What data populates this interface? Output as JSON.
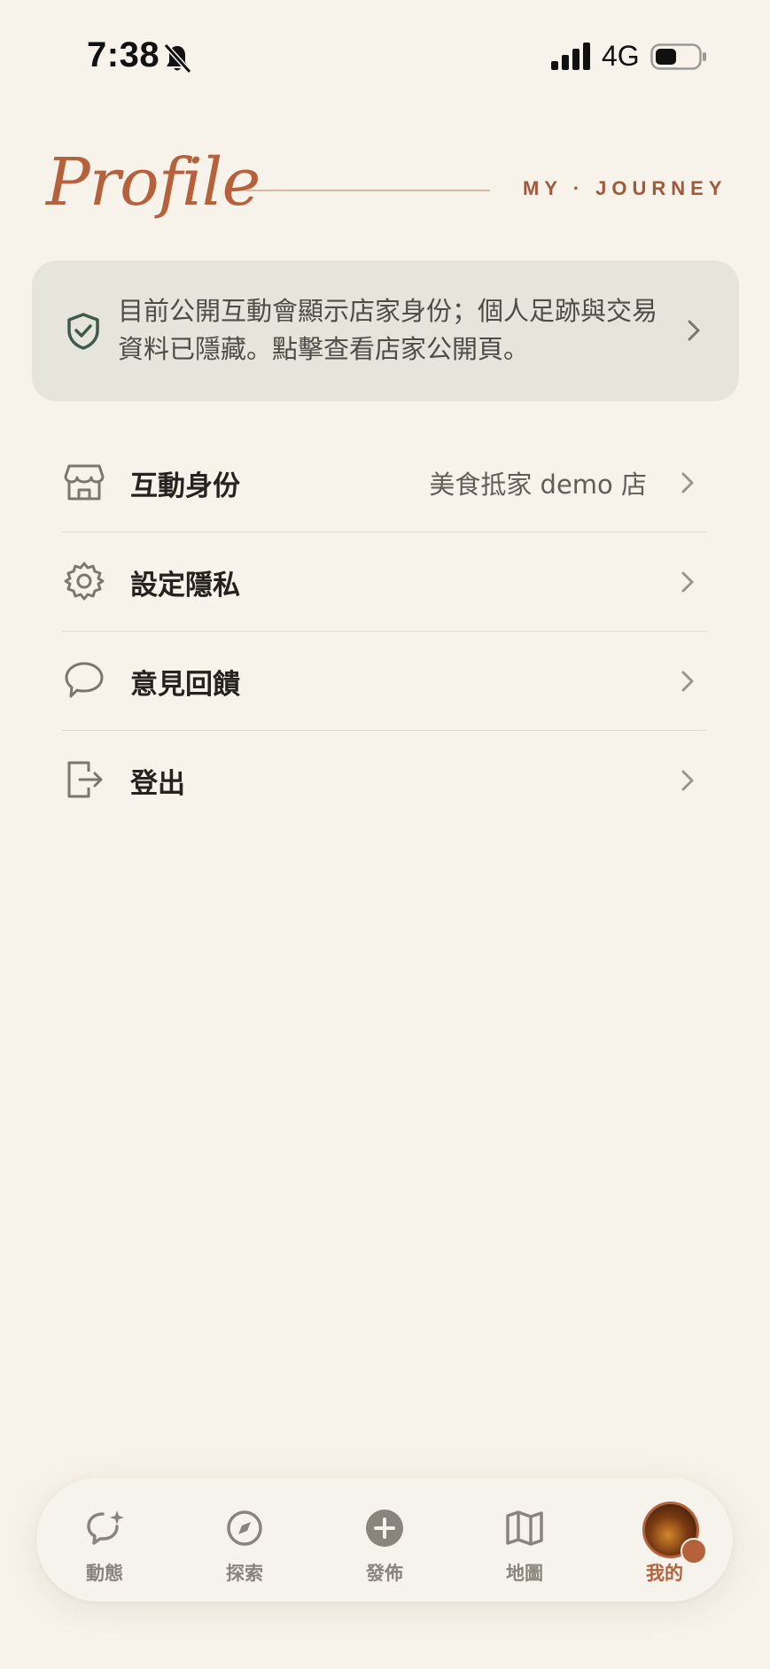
{
  "status_bar": {
    "time": "7:38",
    "network": "4G"
  },
  "header": {
    "title": "Profile",
    "tagline": "MY · JOURNEY"
  },
  "notice": {
    "text": "目前公開互動會顯示店家身份；個人足跡與交易資料已隱藏。點擊查看店家公開頁。"
  },
  "menu": {
    "items": [
      {
        "label": "互動身份",
        "value": "美食抵家 demo 店",
        "icon": "storefront-icon"
      },
      {
        "label": "設定隱私",
        "value": "",
        "icon": "gear-icon"
      },
      {
        "label": "意見回饋",
        "value": "",
        "icon": "speech-bubble-icon"
      },
      {
        "label": "登出",
        "value": "",
        "icon": "logout-icon"
      }
    ]
  },
  "tab_bar": {
    "tabs": [
      {
        "label": "動態",
        "icon": "sparkle-chat-icon"
      },
      {
        "label": "探索",
        "icon": "compass-icon"
      },
      {
        "label": "發佈",
        "icon": "plus-circle-icon"
      },
      {
        "label": "地圖",
        "icon": "map-icon"
      },
      {
        "label": "我的",
        "icon": "avatar"
      }
    ],
    "active_index": 4
  },
  "colors": {
    "background": "#f7f3ea",
    "accent": "#b5613c",
    "notice_bg": "#e6e5dc",
    "muted_icon": "#8a857c"
  }
}
